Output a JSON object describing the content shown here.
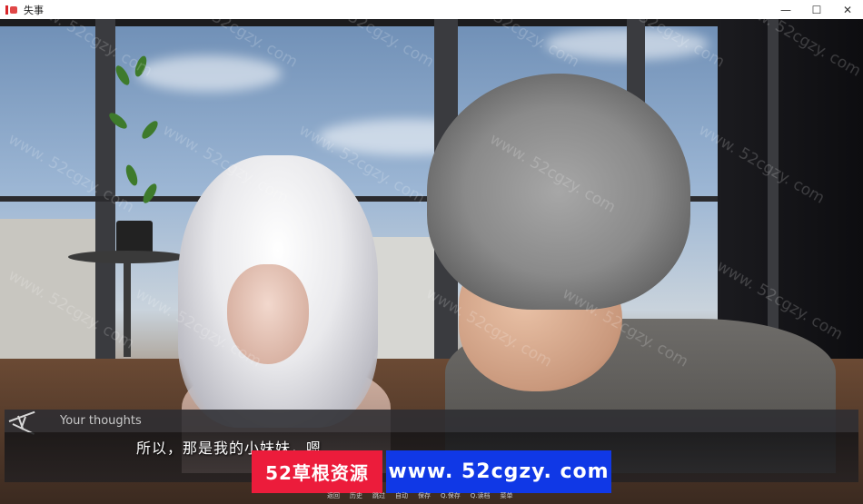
{
  "window": {
    "title": "失事",
    "icon": "app-icon",
    "controls": [
      "minimize-icon",
      "maximize-icon",
      "close-icon"
    ],
    "minimize_glyph": "—",
    "maximize_glyph": "☐",
    "close_glyph": "✕"
  },
  "dialogue": {
    "speaker": "Your thoughts",
    "text": "所以，那是我的小妹妹，嗯"
  },
  "banners": {
    "site_name": "52草根资源",
    "site_url": "www. 52cgzy. com"
  },
  "watermark": "www. 52cgzy. com",
  "quick_menu": [
    "返回",
    "历史",
    "跳过",
    "自动",
    "保存",
    "Q.保存",
    "Q.读档",
    "菜单"
  ],
  "colors": {
    "banner_red": "#ec1c3b",
    "banner_blue": "#1038e6",
    "namebar_bg": "#2d2d32",
    "dialogue_text": "#ffffff"
  }
}
